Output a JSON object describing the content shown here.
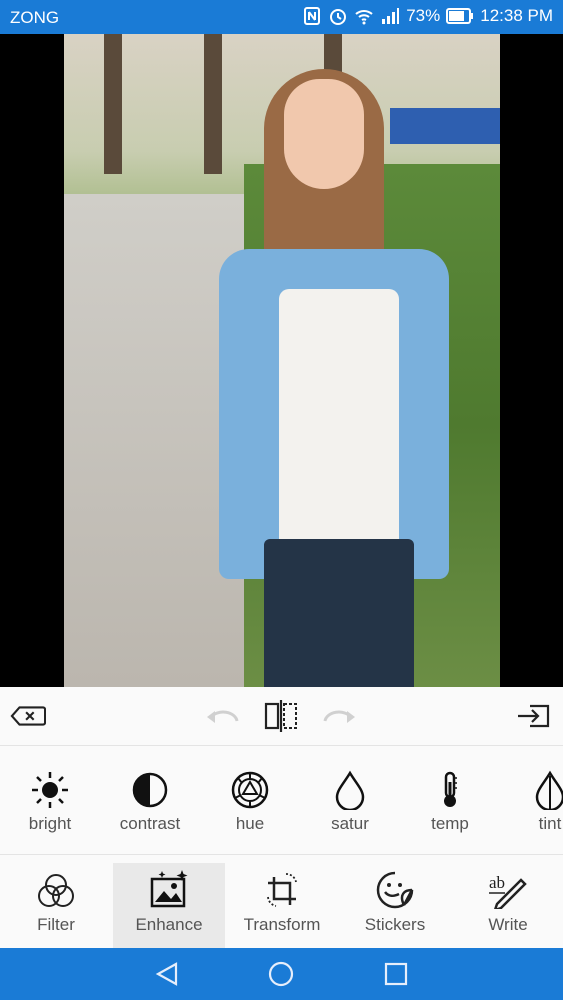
{
  "status_bar": {
    "carrier": "ZONG",
    "battery": "73%",
    "time": "12:38 PM"
  },
  "toolbar": {
    "back_icon": "backspace-icon",
    "undo_icon": "undo-icon",
    "compare_icon": "compare-split-icon",
    "redo_icon": "redo-icon",
    "export_icon": "export-icon"
  },
  "adjust_tools": [
    {
      "label": "bright",
      "icon": "brightness-icon"
    },
    {
      "label": "contrast",
      "icon": "contrast-icon"
    },
    {
      "label": "hue",
      "icon": "hue-icon"
    },
    {
      "label": "satur",
      "icon": "saturation-drop-icon"
    },
    {
      "label": "temp",
      "icon": "thermometer-icon"
    },
    {
      "label": "tint",
      "icon": "tint-drop-icon"
    }
  ],
  "tabs": [
    {
      "label": "Filter",
      "icon": "filter-circles-icon",
      "active": false
    },
    {
      "label": "Enhance",
      "icon": "enhance-image-icon",
      "active": true
    },
    {
      "label": "Transform",
      "icon": "crop-rotate-icon",
      "active": false
    },
    {
      "label": "Stickers",
      "icon": "sticker-face-icon",
      "active": false
    },
    {
      "label": "Write",
      "icon": "text-pen-icon",
      "active": false
    }
  ],
  "colors": {
    "status_bar": "#1a7bd6",
    "nav_bar": "#1a7bd6",
    "panel_bg": "#fafafa",
    "active_tab": "#e9e9e9",
    "label": "#555555"
  }
}
